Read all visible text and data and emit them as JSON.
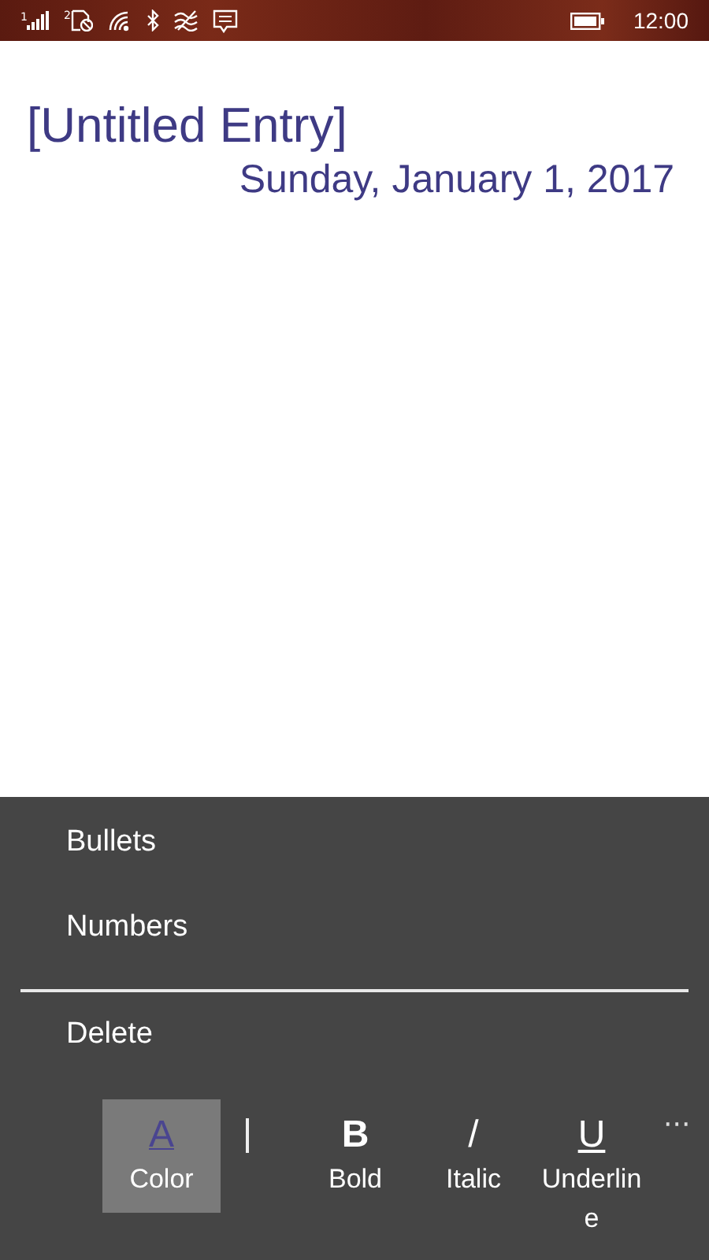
{
  "status_bar": {
    "sim1": "1",
    "sim2": "2",
    "time": "12:00"
  },
  "entry": {
    "title": "[Untitled Entry]",
    "date": "Sunday, January 1, 2017"
  },
  "menu": {
    "items": [
      {
        "label": "Bullets",
        "kind": "item"
      },
      {
        "label": "Numbers",
        "kind": "item"
      },
      {
        "kind": "divider"
      },
      {
        "label": "Delete",
        "kind": "item"
      }
    ]
  },
  "toolbar": {
    "buttons": [
      {
        "glyph": "A",
        "label": "Color",
        "kind": "color",
        "selected": true
      },
      {
        "kind": "separator"
      },
      {
        "glyph": "B",
        "label": "Bold",
        "kind": "bold",
        "selected": false
      },
      {
        "glyph": "/",
        "label": "Italic",
        "kind": "italic",
        "selected": false
      },
      {
        "glyph": "U",
        "label": "Underline",
        "kind": "underline",
        "selected": false
      }
    ],
    "more": "···"
  }
}
